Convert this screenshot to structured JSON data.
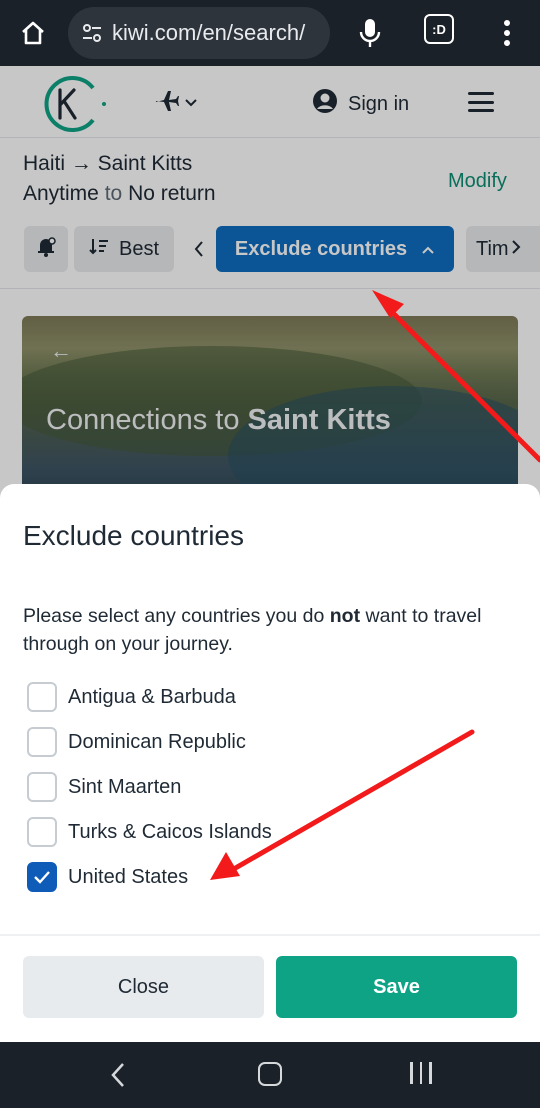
{
  "browser": {
    "url": "kiwi.com/en/search/",
    "tabs_label": ":D"
  },
  "header": {
    "sign_in": "Sign in"
  },
  "search": {
    "route": "Haiti → Saint Kitts",
    "dates_from": "Anytime",
    "dates_to_word": "to",
    "dates_to": "No return",
    "modify": "Modify"
  },
  "filters": {
    "sort_label": "Best",
    "exclude_label": "Exclude countries",
    "time_label": "Tim"
  },
  "hero": {
    "title_prefix": "Connections to",
    "title_place": "Saint Kitts"
  },
  "sheet": {
    "title": "Exclude countries",
    "desc_before": "Please select any countries you do ",
    "desc_bold": "not",
    "desc_after": " want to travel through on your journey.",
    "options": [
      {
        "label": "Antigua & Barbuda",
        "checked": false
      },
      {
        "label": "Dominican Republic",
        "checked": false
      },
      {
        "label": "Sint Maarten",
        "checked": false
      },
      {
        "label": "Turks & Caicos Islands",
        "checked": false
      },
      {
        "label": "United States",
        "checked": true
      }
    ],
    "close": "Close",
    "save": "Save"
  },
  "colors": {
    "brand_green": "#0fa386",
    "active_blue": "#0f6cbf",
    "annotation_red": "#f21a1a"
  }
}
